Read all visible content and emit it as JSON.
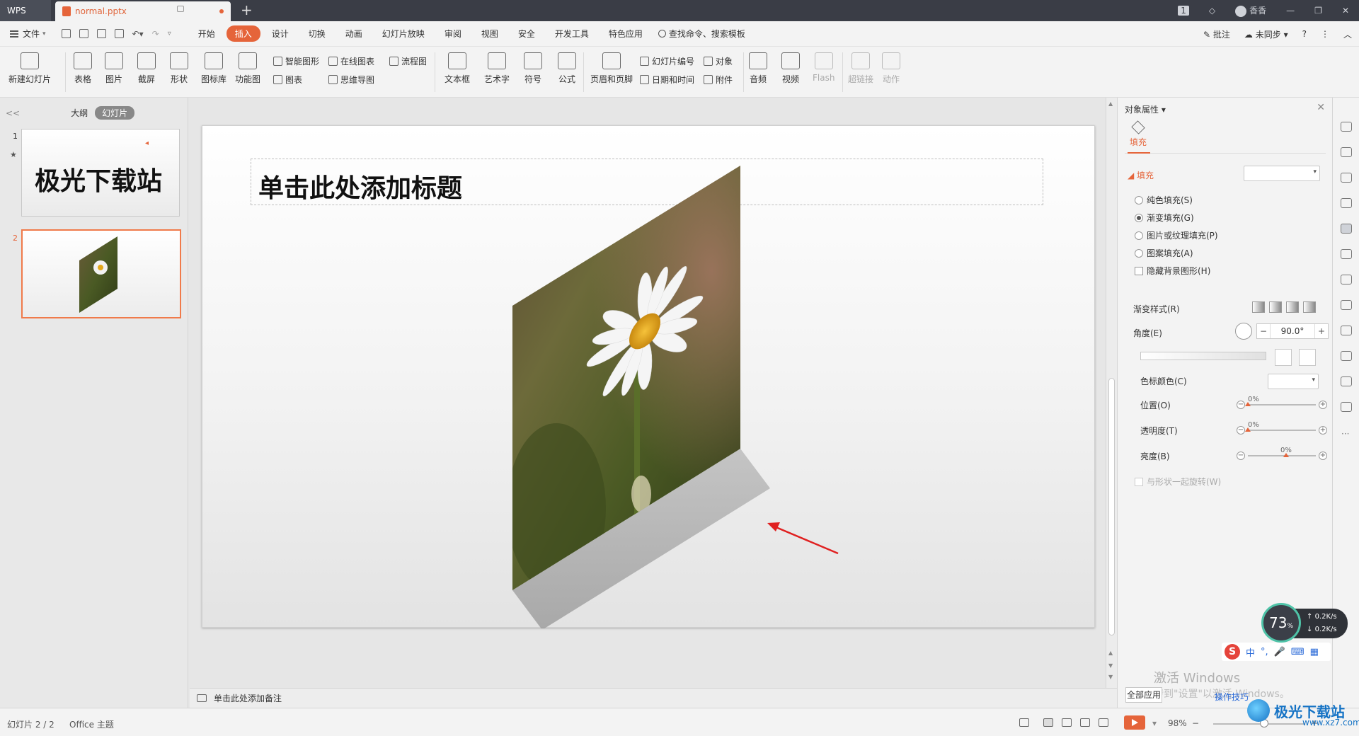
{
  "titlebar": {
    "app_tab": "WPS",
    "doc_tab": "normal.pptx",
    "new_tab": "+",
    "badge": "1",
    "user": "香香",
    "minimize": "—",
    "restore": "❐",
    "close": "✕"
  },
  "menubar": {
    "file": "文件",
    "tabs": [
      "开始",
      "插入",
      "设计",
      "切换",
      "动画",
      "幻灯片放映",
      "审阅",
      "视图",
      "安全",
      "开发工具",
      "特色应用"
    ],
    "active_tab": "插入",
    "search": "查找命令、搜索模板",
    "comment": "批注",
    "sync": "未同步",
    "help": "?",
    "more": "⋮",
    "collapse": "︿"
  },
  "ribbon": {
    "new_slide": "新建幻灯片",
    "table": "表格",
    "picture": "图片",
    "screenshot": "截屏",
    "shape": "形状",
    "icon_lib": "图标库",
    "func_chart": "功能图",
    "smart_art": "智能图形",
    "online_chart": "在线图表",
    "flowchart": "流程图",
    "chart": "图表",
    "mindmap": "思维导图",
    "textbox": "文本框",
    "wordart": "艺术字",
    "symbol": "符号",
    "formula": "公式",
    "header_footer": "页眉和页脚",
    "slide_number": "幻灯片编号",
    "object": "对象",
    "datetime": "日期和时间",
    "attachment": "附件",
    "audio": "音频",
    "video": "视频",
    "flash": "Flash",
    "hyperlink": "超链接",
    "action": "动作"
  },
  "leftpanel": {
    "collapse": "<<",
    "tab_outline": "大纲",
    "tab_slides": "幻灯片",
    "slides": [
      {
        "num": "1",
        "title": "极光下载站",
        "marker": "◂"
      },
      {
        "num": "2"
      }
    ],
    "star": "★"
  },
  "slide": {
    "title_placeholder": "单击此处添加标题"
  },
  "notes": {
    "placeholder": "单击此处添加备注"
  },
  "rpanel": {
    "header": "对象属性",
    "close": "✕",
    "fill_tab": "填充",
    "section": "填充",
    "options": [
      "纯色填充(S)",
      "渐变填充(G)",
      "图片或纹理填充(P)",
      "图案填充(A)"
    ],
    "selected_option": "渐变填充(G)",
    "hide_bg": "隐藏背景图形(H)",
    "gradient_style": "渐变样式(R)",
    "angle_label": "角度(E)",
    "angle_value": "90.0°",
    "stop_color": "色标颜色(C)",
    "position_label": "位置(O)",
    "position_value": "0%",
    "transparency_label": "透明度(T)",
    "transparency_value": "0%",
    "brightness_label": "亮度(B)",
    "brightness_value": "0%",
    "rotate_with_shape": "与形状一起旋转(W)"
  },
  "statusbar": {
    "slide_info": "幻灯片 2 / 2",
    "theme": "Office 主题",
    "zoom": "98%",
    "zoom_minus": "−",
    "zoom_plus": "+"
  },
  "overlays": {
    "speed_percent": "73",
    "speed_unit": "%",
    "up_speed": "0.2K/s",
    "down_speed": "0.2K/s",
    "ime_logo": "S",
    "ime_items": [
      "中",
      "°,",
      "🎤",
      "⌨",
      "▦"
    ],
    "activate_windows": "激活 Windows",
    "activate_hint": "转到\"设置\"以激活 Windows。",
    "all_apps": "全部应用",
    "tips": "操作技巧",
    "brand": "极光下载站",
    "brand_url": "www.xz7.com"
  }
}
